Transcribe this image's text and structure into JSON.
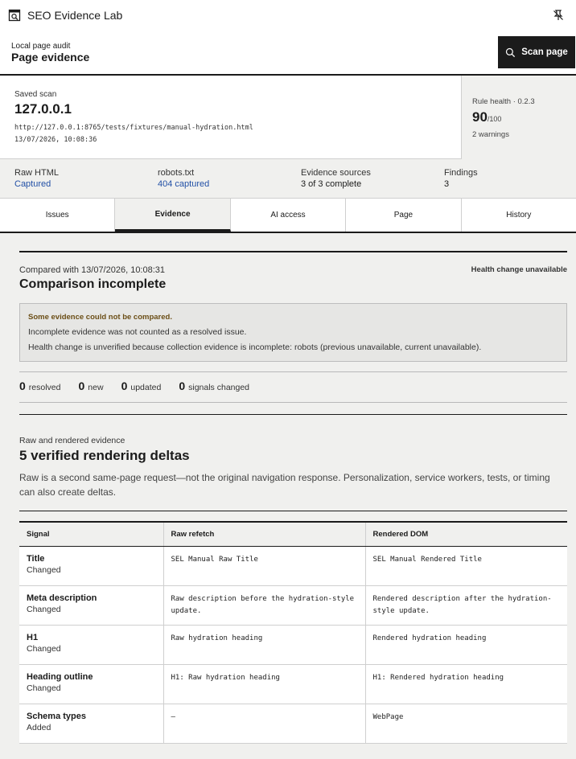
{
  "app": {
    "title": "SEO Evidence Lab"
  },
  "header": {
    "kicker": "Local page audit",
    "title": "Page evidence",
    "scan_button": "Scan page"
  },
  "scan": {
    "label": "Saved scan",
    "host": "127.0.0.1",
    "url": "http://127.0.0.1:8765/tests/fixtures/manual-hydration.html",
    "timestamp": "13/07/2026, 10:08:36",
    "rule_health_label": "Rule health · 0.2.3",
    "score": "90",
    "score_suffix": "/100",
    "warnings": "2 warnings"
  },
  "stats": [
    {
      "label": "Raw HTML",
      "value": "Captured"
    },
    {
      "label": "robots.txt",
      "value": "404 captured"
    },
    {
      "label": "Evidence sources",
      "value": "3 of 3 complete"
    },
    {
      "label": "Findings",
      "value": "3"
    }
  ],
  "tabs": [
    {
      "label": "Issues"
    },
    {
      "label": "Evidence"
    },
    {
      "label": "AI access"
    },
    {
      "label": "Page"
    },
    {
      "label": "History"
    }
  ],
  "active_tab": "Evidence",
  "comparison": {
    "compared_with": "Compared with 13/07/2026, 10:08:31",
    "title": "Comparison incomplete",
    "health_change": "Health change unavailable",
    "alert_title": "Some evidence could not be compared.",
    "alert_line1": "Incomplete evidence was not counted as a resolved issue.",
    "alert_line2": "Health change is unverified because collection evidence is incomplete: robots (previous unavailable, current unavailable).",
    "counts": [
      {
        "n": "0",
        "label": "resolved"
      },
      {
        "n": "0",
        "label": "new"
      },
      {
        "n": "0",
        "label": "updated"
      },
      {
        "n": "0",
        "label": "signals changed"
      }
    ]
  },
  "rendering": {
    "kicker": "Raw and rendered evidence",
    "title": "5 verified rendering deltas",
    "description": "Raw is a second same-page request—not the original navigation response. Personalization, service workers, tests, or timing can also create deltas.",
    "columns": [
      "Signal",
      "Raw refetch",
      "Rendered DOM"
    ],
    "rows": [
      {
        "signal": "Title",
        "status": "Changed",
        "raw": "SEL Manual Raw Title",
        "rendered": "SEL Manual Rendered Title"
      },
      {
        "signal": "Meta description",
        "status": "Changed",
        "raw": "Raw description before the hydration-style update.",
        "rendered": "Rendered description after the hydration-style update."
      },
      {
        "signal": "H1",
        "status": "Changed",
        "raw": "Raw hydration heading",
        "rendered": "Rendered hydration heading"
      },
      {
        "signal": "Heading outline",
        "status": "Changed",
        "raw": "H1: Raw hydration heading",
        "rendered": "H1: Rendered hydration heading"
      },
      {
        "signal": "Schema types",
        "status": "Added",
        "raw": "—",
        "rendered": "WebPage"
      }
    ]
  }
}
